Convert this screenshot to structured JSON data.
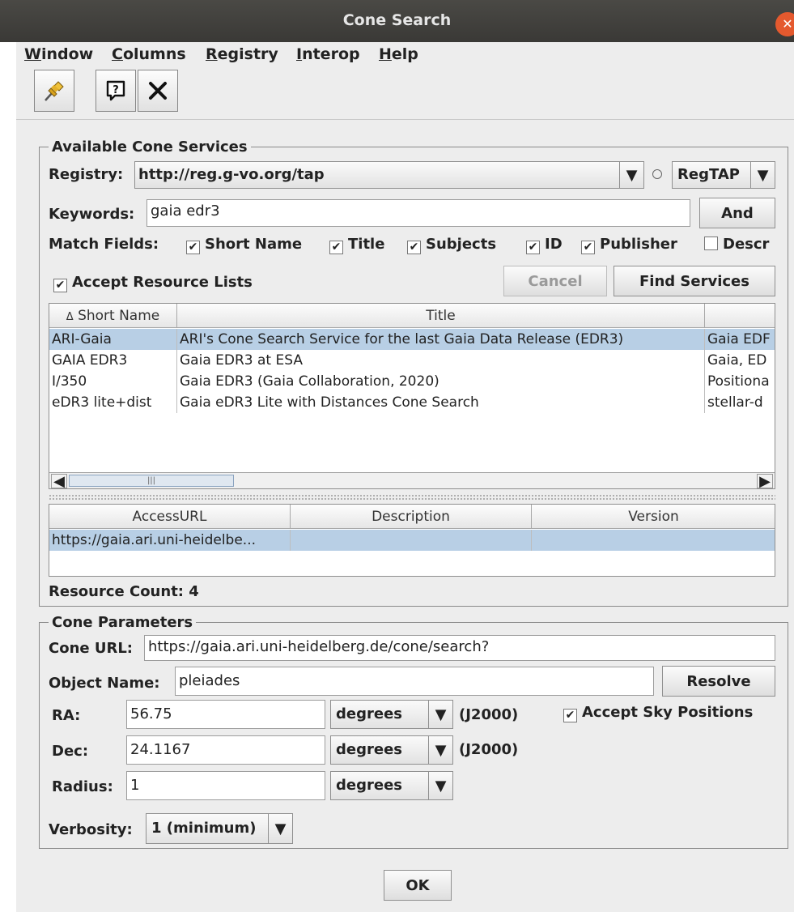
{
  "window": {
    "title": "Cone Search"
  },
  "menu": [
    {
      "mnemonic": "W",
      "rest": "indow"
    },
    {
      "mnemonic": "C",
      "rest": "olumns"
    },
    {
      "mnemonic": "R",
      "rest": "egistry"
    },
    {
      "mnemonic": "I",
      "rest": "nterop"
    },
    {
      "mnemonic": "H",
      "rest": "elp"
    }
  ],
  "toolbar": {
    "pin_icon": "pin-icon",
    "help_icon": "help-icon",
    "close_icon": "close-icon"
  },
  "services": {
    "legend": "Available Cone Services",
    "registry_label": "Registry:",
    "registry_value": "http://reg.g-vo.org/tap",
    "registry_protocol": "RegTAP",
    "keywords_label": "Keywords:",
    "keywords_value": "gaia edr3",
    "and_button": "And",
    "match_label": "Match Fields:",
    "match_fields": [
      {
        "label": "Short Name",
        "checked": true
      },
      {
        "label": "Title",
        "checked": true
      },
      {
        "label": "Subjects",
        "checked": true
      },
      {
        "label": "ID",
        "checked": true
      },
      {
        "label": "Publisher",
        "checked": true
      },
      {
        "label": "Descr",
        "checked": false
      }
    ],
    "accept_lists_label": "Accept Resource Lists",
    "cancel_button": "Cancel",
    "find_button": "Find Services",
    "table_headers": [
      "Short Name",
      "Title",
      ""
    ],
    "sort_glyph": "Δ",
    "rows": [
      [
        "ARI-Gaia",
        "ARI's Cone Search Service for the last Gaia Data Release (EDR3)",
        "Gaia EDF"
      ],
      [
        "GAIA EDR3",
        "Gaia EDR3 at ESA",
        "Gaia, ED"
      ],
      [
        "I/350",
        "Gaia EDR3 (Gaia Collaboration, 2020)",
        "Positiona"
      ],
      [
        "eDR3 lite+dist",
        "Gaia eDR3 Lite with Distances Cone Search",
        "stellar-d"
      ]
    ],
    "scrollbar_grip": "|||",
    "detail_headers": [
      "AccessURL",
      "Description",
      "Version"
    ],
    "detail_rows": [
      [
        "https://gaia.ari.uni-heidelbe...",
        "",
        ""
      ]
    ],
    "resource_count": "Resource Count: 4"
  },
  "cone": {
    "legend": "Cone Parameters",
    "url_label": "Cone URL:",
    "url_value": "https://gaia.ari.uni-heidelberg.de/cone/search?",
    "object_label": "Object Name:",
    "object_value": "pleiades",
    "resolve_button": "Resolve",
    "ra_label": "RA:",
    "ra_value": "56.75",
    "ra_unit": "degrees",
    "ra_epoch": "(J2000)",
    "dec_label": "Dec:",
    "dec_value": "24.1167",
    "dec_unit": "degrees",
    "dec_epoch": "(J2000)",
    "radius_label": "Radius:",
    "radius_value": "1",
    "radius_unit": "degrees",
    "accept_sky_label": "Accept Sky Positions",
    "verbosity_label": "Verbosity:",
    "verbosity_value": "1 (minimum)"
  },
  "ok_button": "OK"
}
